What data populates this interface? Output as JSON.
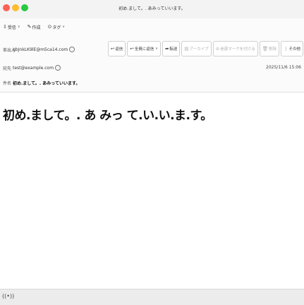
{
  "window": {
    "title": "初め.まして。. あみっていいます。",
    "traffic_lights": {
      "close": "#ff5f57",
      "minimize": "#febc2e",
      "zoom": "#28c840"
    }
  },
  "menubar": {
    "items": [
      {
        "label": "受信",
        "icon": "download-icon",
        "glyph": "⇩",
        "has_dropdown": true
      },
      {
        "label": "作成",
        "icon": "pencil-icon",
        "glyph": "✎",
        "has_dropdown": false
      },
      {
        "label": "タグ",
        "icon": "tag-icon",
        "glyph": "⊙",
        "has_dropdown": true
      }
    ]
  },
  "message": {
    "from_label": "差出人",
    "from": "gbJnkLK9lE@m5ca14.com",
    "to_label": "宛先",
    "to": "test@example.com",
    "subject_label": "件名",
    "subject": "初め.まして。. あみっていいます。",
    "date": "2025/11/6 15:06",
    "body": "初め.まして。. あ みっ て.い.い.ま.す。"
  },
  "actions": [
    {
      "name": "reply-button",
      "label": "返信",
      "glyph": "↩",
      "disabled": false,
      "dropdown": false
    },
    {
      "name": "reply-all-button",
      "label": "全員に返信",
      "glyph": "↩",
      "disabled": false,
      "dropdown": true
    },
    {
      "name": "forward-button",
      "label": "転送",
      "glyph": "➦",
      "disabled": false,
      "dropdown": false
    },
    {
      "name": "archive-button",
      "label": "アーカイブ",
      "glyph": "▤",
      "disabled": true,
      "dropdown": false
    },
    {
      "name": "junk-button",
      "label": "迷惑マークを付ける",
      "glyph": "⊘",
      "disabled": true,
      "dropdown": false
    },
    {
      "name": "delete-button",
      "label": "削除",
      "glyph": "🗑",
      "disabled": true,
      "dropdown": false
    },
    {
      "name": "more-button",
      "label": "その他",
      "glyph": "⋮",
      "disabled": false,
      "dropdown": false
    }
  ],
  "statusbar": {
    "icon": "wifi-icon",
    "glyph": "((•))"
  }
}
